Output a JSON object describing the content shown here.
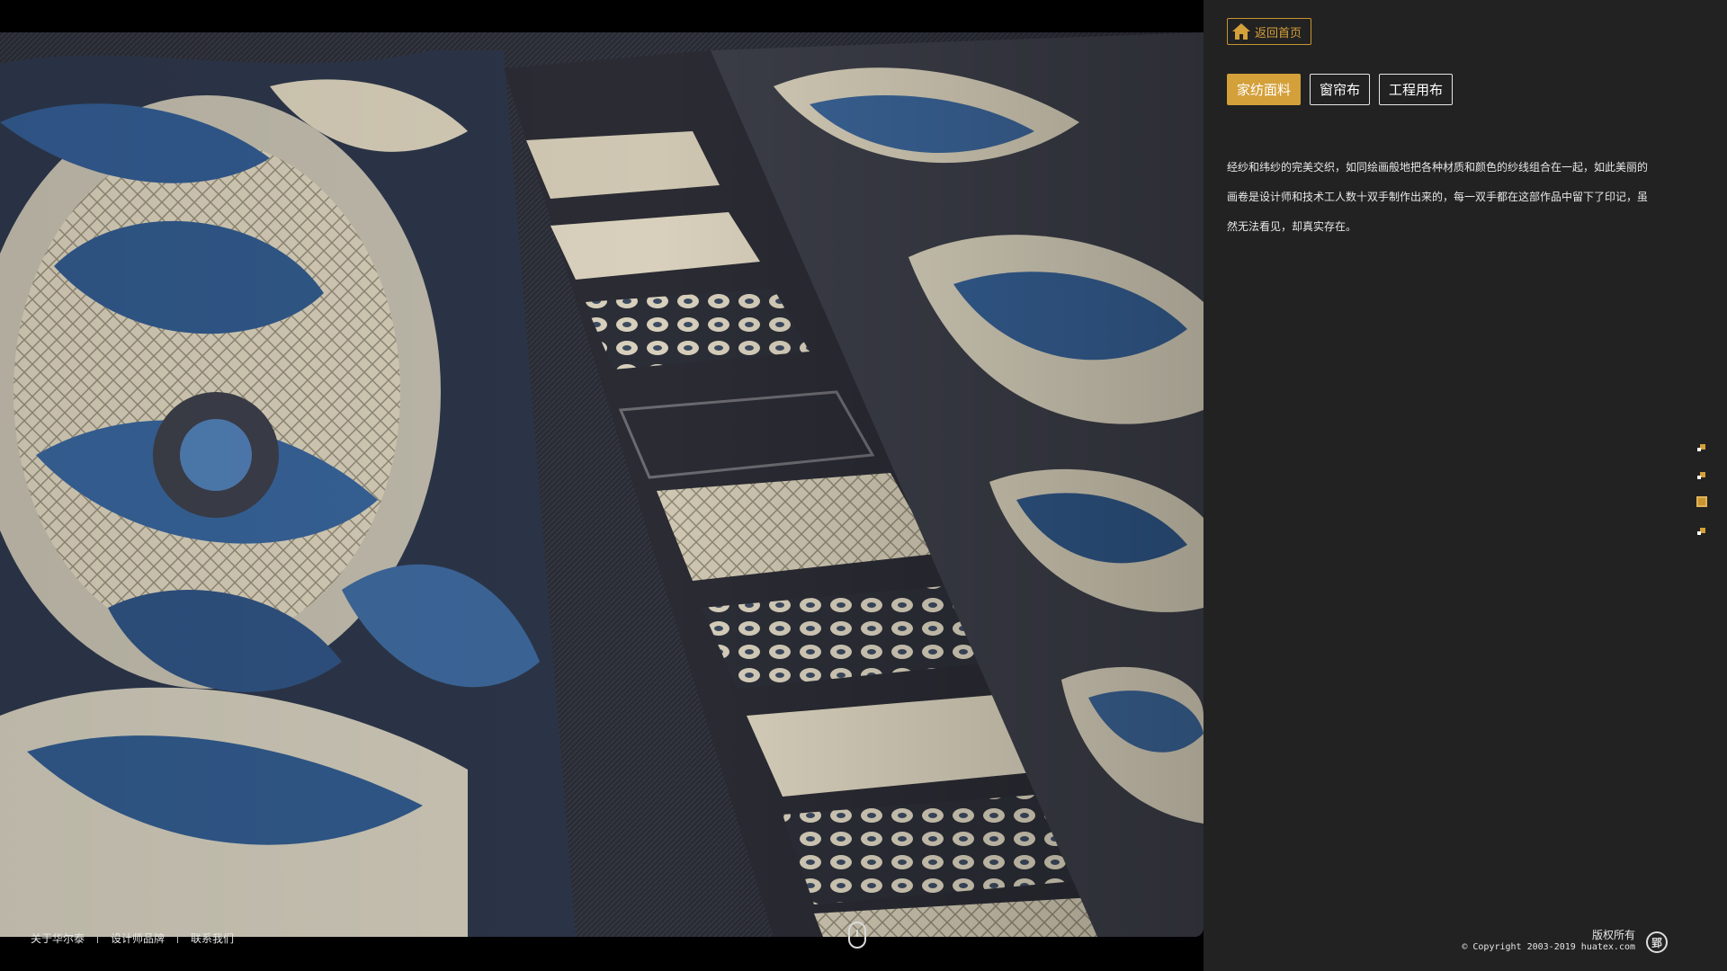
{
  "nav": {
    "home_label": "返回首页",
    "tabs": [
      {
        "label": "家纺面料",
        "active": true
      },
      {
        "label": "窗帘布",
        "active": false
      },
      {
        "label": "工程用布",
        "active": false
      }
    ]
  },
  "description": "经纱和纬纱的完美交织，如同绘画般地把各种材质和颜色的纱线组合在一起，如此美丽的画卷是设计师和技术工人数十双手制作出来的，每一双手都在这部作品中留下了印记，虽然无法看见，却真实存在。",
  "footer": {
    "links": [
      "关于华尔泰",
      "设计师品牌",
      "联系我们"
    ],
    "rights": "版权所有",
    "copyright": "© Copyright 2003-2019 huatex.com",
    "badge": "郢"
  },
  "colors": {
    "accent": "#d4a03a",
    "panel_bg": "#222222",
    "fabric_navy": "#2f4f78",
    "fabric_cream": "#d9d2bf",
    "fabric_dark": "#2a2b33"
  },
  "icons": {
    "home": "home-icon",
    "scroll": "mouse-scroll-icon"
  }
}
